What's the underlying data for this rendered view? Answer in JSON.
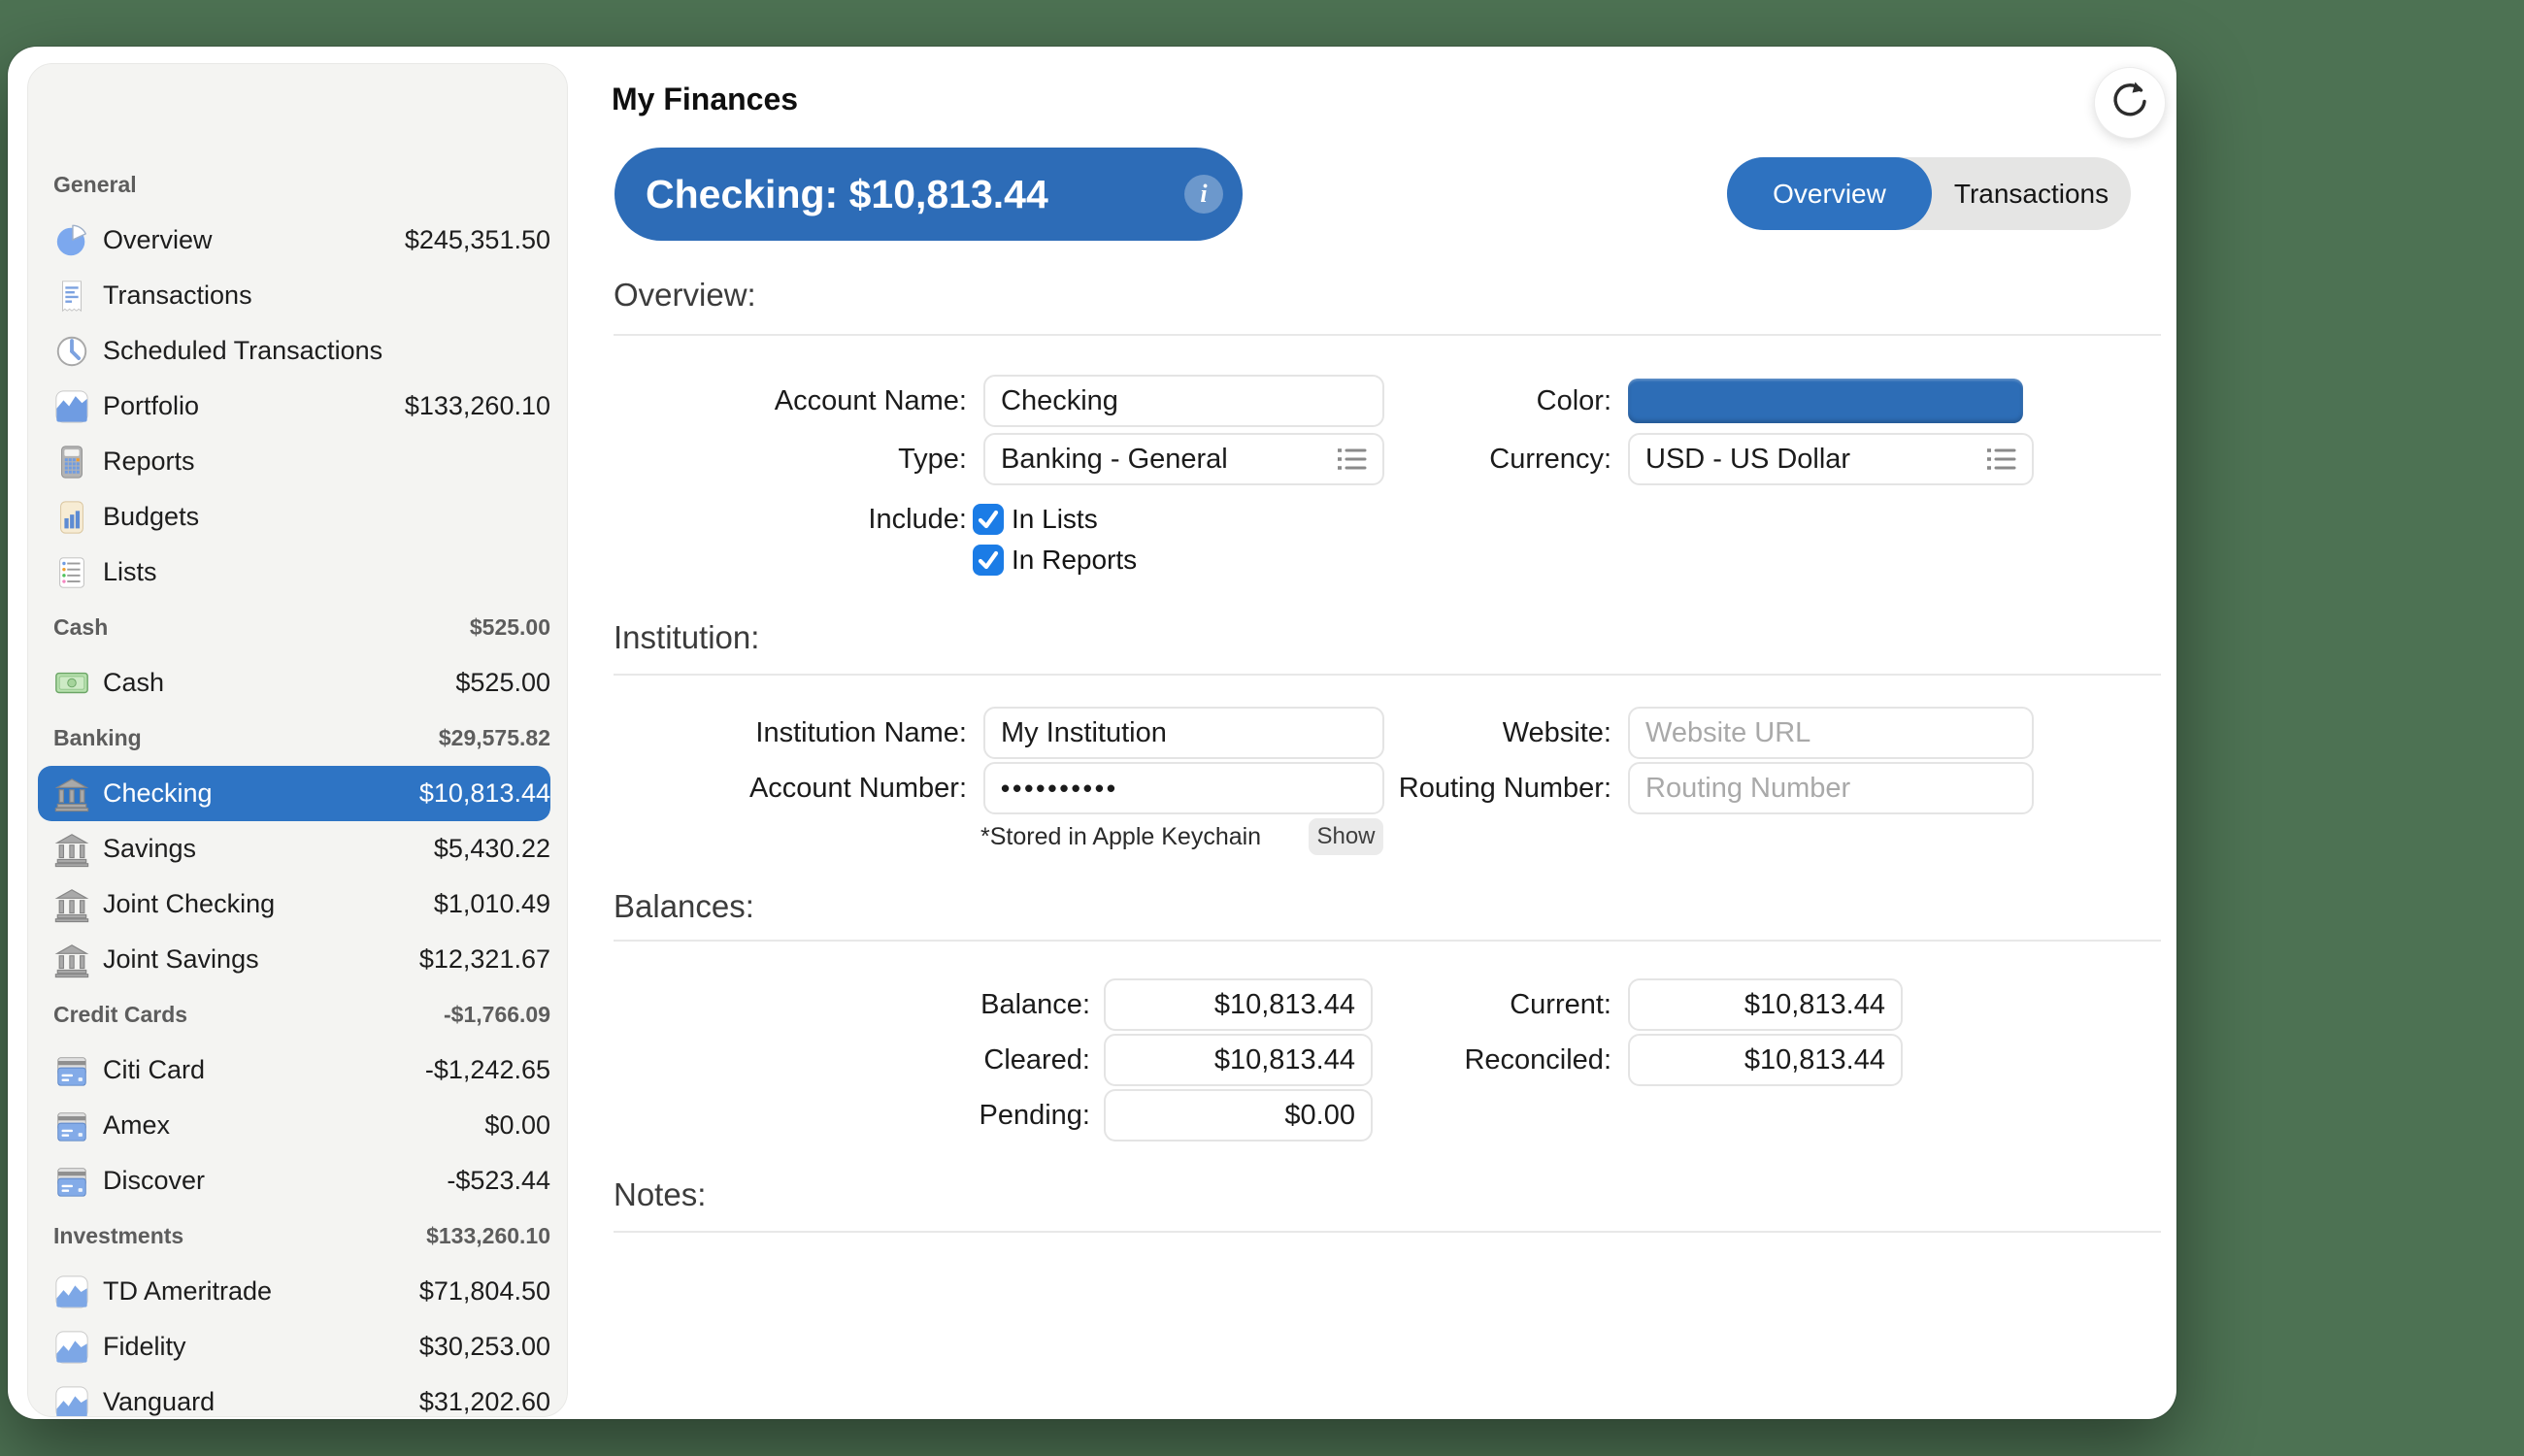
{
  "desktop": {
    "background": "#4d7253"
  },
  "window": {
    "traffic_lights": {
      "close": "#ff5f57",
      "minimize": "#febc2e",
      "zoom": "#28c840"
    }
  },
  "sidebar": {
    "sections": [
      {
        "label": "General",
        "value": "",
        "items": [
          {
            "icon": "pie",
            "label": "Overview",
            "value": "$245,351.50",
            "selected": false
          },
          {
            "icon": "receipt",
            "label": "Transactions",
            "value": "",
            "selected": false
          },
          {
            "icon": "clock",
            "label": "Scheduled Transactions",
            "value": "",
            "selected": false
          },
          {
            "icon": "portfolio",
            "label": "Portfolio",
            "value": "$133,260.10",
            "selected": false
          },
          {
            "icon": "calculator",
            "label": "Reports",
            "value": "",
            "selected": false
          },
          {
            "icon": "budget",
            "label": "Budgets",
            "value": "",
            "selected": false
          },
          {
            "icon": "list",
            "label": "Lists",
            "value": "",
            "selected": false
          }
        ]
      },
      {
        "label": "Cash",
        "value": "$525.00",
        "items": [
          {
            "icon": "banknote",
            "label": "Cash",
            "value": "$525.00",
            "selected": false
          }
        ]
      },
      {
        "label": "Banking",
        "value": "$29,575.82",
        "items": [
          {
            "icon": "bank",
            "label": "Checking",
            "value": "$10,813.44",
            "selected": true
          },
          {
            "icon": "bank",
            "label": "Savings",
            "value": "$5,430.22",
            "selected": false
          },
          {
            "icon": "bank",
            "label": "Joint Checking",
            "value": "$1,010.49",
            "selected": false
          },
          {
            "icon": "bank",
            "label": "Joint Savings",
            "value": "$12,321.67",
            "selected": false
          }
        ]
      },
      {
        "label": "Credit Cards",
        "value": "-$1,766.09",
        "items": [
          {
            "icon": "card",
            "label": "Citi Card",
            "value": "-$1,242.65",
            "selected": false
          },
          {
            "icon": "card",
            "label": "Amex",
            "value": "$0.00",
            "selected": false
          },
          {
            "icon": "card",
            "label": "Discover",
            "value": "-$523.44",
            "selected": false
          }
        ]
      },
      {
        "label": "Investments",
        "value": "$133,260.10",
        "items": [
          {
            "icon": "invest",
            "label": "TD Ameritrade",
            "value": "$71,804.50",
            "selected": false
          },
          {
            "icon": "invest",
            "label": "Fidelity",
            "value": "$30,253.00",
            "selected": false
          },
          {
            "icon": "invest",
            "label": "Vanguard",
            "value": "$31,202.60",
            "selected": false
          }
        ]
      }
    ]
  },
  "header": {
    "title": "My Finances",
    "pill": {
      "label": "Checking: $10,813.44",
      "info_glyph": "i",
      "color": "#2d6cb7"
    },
    "tabs": [
      {
        "label": "Overview",
        "active": true
      },
      {
        "label": "Transactions",
        "active": false
      }
    ]
  },
  "form": {
    "overview": {
      "heading": "Overview:",
      "account_name": {
        "label": "Account Name:",
        "value": "Checking"
      },
      "color": {
        "label": "Color:",
        "value": "#2d6db6"
      },
      "type": {
        "label": "Type:",
        "value": "Banking - General"
      },
      "currency": {
        "label": "Currency:",
        "value": "USD - US Dollar"
      },
      "include": {
        "label": "Include:",
        "options": [
          {
            "label": "In Lists",
            "checked": true
          },
          {
            "label": "In Reports",
            "checked": true
          }
        ]
      }
    },
    "institution": {
      "heading": "Institution:",
      "institution_name": {
        "label": "Institution Name:",
        "value": "My Institution"
      },
      "website": {
        "label": "Website:",
        "placeholder": "Website URL"
      },
      "account_number": {
        "label": "Account Number:",
        "value": "••••••••••"
      },
      "routing_number": {
        "label": "Routing Number:",
        "placeholder": "Routing Number"
      },
      "keychain_note": "*Stored in Apple Keychain",
      "show_button": "Show"
    },
    "balances": {
      "heading": "Balances:",
      "balance": {
        "label": "Balance:",
        "value": "$10,813.44"
      },
      "current": {
        "label": "Current:",
        "value": "$10,813.44"
      },
      "cleared": {
        "label": "Cleared:",
        "value": "$10,813.44"
      },
      "reconciled": {
        "label": "Reconciled:",
        "value": "$10,813.44"
      },
      "pending": {
        "label": "Pending:",
        "value": "$0.00"
      }
    },
    "notes": {
      "heading": "Notes:"
    }
  }
}
